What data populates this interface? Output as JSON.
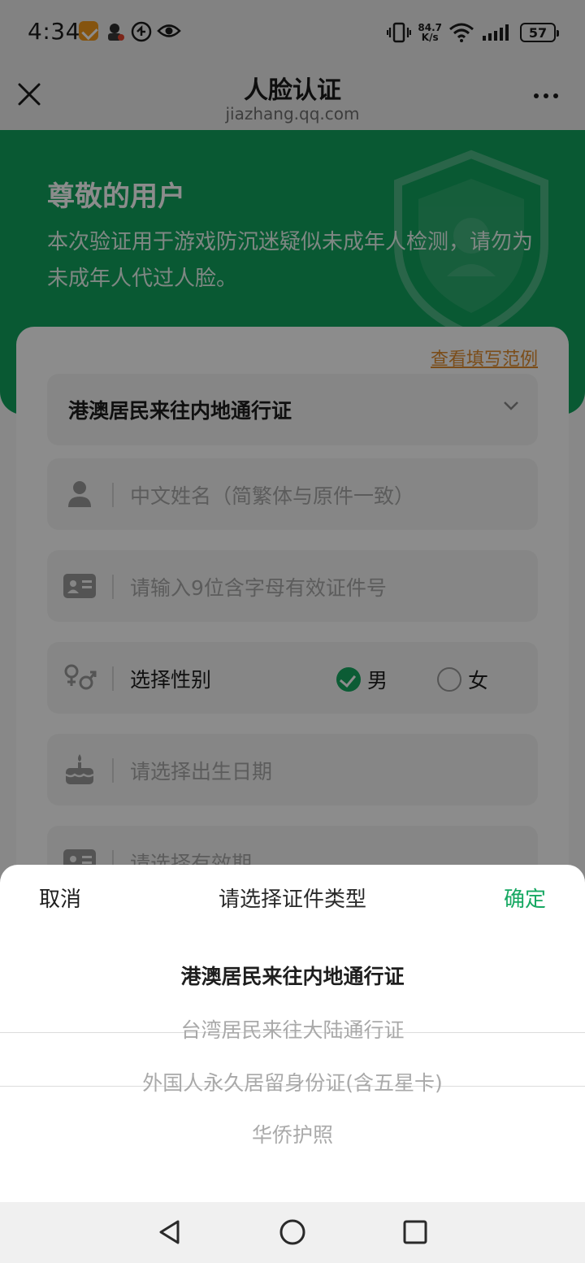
{
  "status_bar": {
    "time": "4:34",
    "net_speed_value": "84.7",
    "net_speed_unit": "K/s",
    "battery": "57"
  },
  "title_bar": {
    "title": "人脸认证",
    "subtitle": "jiazhang.qq.com"
  },
  "hero": {
    "greeting": "尊敬的用户",
    "description": "本次验证用于游戏防沉迷疑似未成年人检测，请勿为未成年人代过人脸。"
  },
  "form": {
    "example_link": "查看填写范例",
    "id_type_value": "港澳居民来往内地通行证",
    "name_placeholder": "中文姓名（简繁体与原件一致）",
    "id_number_placeholder": "请输入9位含字母有效证件号",
    "gender_label": "选择性别",
    "gender_options": [
      "男",
      "女"
    ],
    "gender_selected": "男",
    "birth_placeholder": "请选择出生日期",
    "validity_placeholder": "请选择有效期"
  },
  "picker": {
    "cancel_label": "取消",
    "title": "请选择证件类型",
    "confirm_label": "确定",
    "options": [
      "港澳居民来往内地通行证",
      "台湾居民来往大陆通行证",
      "外国人永久居留身份证(含五星卡)",
      "华侨护照"
    ],
    "selected_index": 0
  },
  "colors": {
    "brand_green": "#12a25d",
    "confirm_green": "#16a862",
    "link_orange": "#e08d2e"
  },
  "icons": {
    "title_close": "close-icon",
    "title_more": "more-icon",
    "field_name": "person-icon",
    "field_id": "id-card-icon",
    "field_gender": "gender-icon",
    "field_birth": "cake-icon",
    "field_validity": "id-card-icon",
    "nav_back": "back-triangle-icon",
    "nav_home": "home-circle-icon",
    "nav_recent": "recent-square-icon"
  }
}
